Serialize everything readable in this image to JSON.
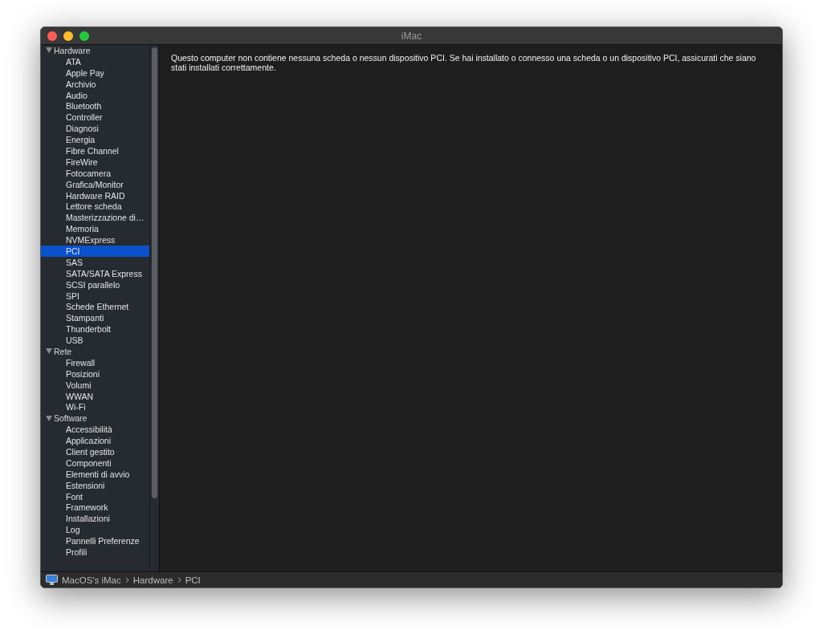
{
  "window": {
    "title": "iMac"
  },
  "sidebar": {
    "sections": [
      {
        "label": "Hardware",
        "expanded": true,
        "children": [
          {
            "label": "ATA",
            "selected": false
          },
          {
            "label": "Apple Pay",
            "selected": false
          },
          {
            "label": "Archivio",
            "selected": false
          },
          {
            "label": "Audio",
            "selected": false
          },
          {
            "label": "Bluetooth",
            "selected": false
          },
          {
            "label": "Controller",
            "selected": false
          },
          {
            "label": "Diagnosi",
            "selected": false
          },
          {
            "label": "Energia",
            "selected": false
          },
          {
            "label": "Fibre Channel",
            "selected": false
          },
          {
            "label": "FireWire",
            "selected": false
          },
          {
            "label": "Fotocamera",
            "selected": false
          },
          {
            "label": "Grafica/Monitor",
            "selected": false
          },
          {
            "label": "Hardware RAID",
            "selected": false
          },
          {
            "label": "Lettore scheda",
            "selected": false
          },
          {
            "label": "Masterizzazione di…",
            "selected": false
          },
          {
            "label": "Memoria",
            "selected": false
          },
          {
            "label": "NVMExpress",
            "selected": false
          },
          {
            "label": "PCI",
            "selected": true
          },
          {
            "label": "SAS",
            "selected": false
          },
          {
            "label": "SATA/SATA Express",
            "selected": false
          },
          {
            "label": "SCSI parallelo",
            "selected": false
          },
          {
            "label": "SPI",
            "selected": false
          },
          {
            "label": "Schede Ethernet",
            "selected": false
          },
          {
            "label": "Stampanti",
            "selected": false
          },
          {
            "label": "Thunderbolt",
            "selected": false
          },
          {
            "label": "USB",
            "selected": false
          }
        ]
      },
      {
        "label": "Rete",
        "expanded": true,
        "children": [
          {
            "label": "Firewall",
            "selected": false
          },
          {
            "label": "Posizioni",
            "selected": false
          },
          {
            "label": "Volumi",
            "selected": false
          },
          {
            "label": "WWAN",
            "selected": false
          },
          {
            "label": "Wi-Fi",
            "selected": false
          }
        ]
      },
      {
        "label": "Software",
        "expanded": true,
        "children": [
          {
            "label": "Accessibilità",
            "selected": false
          },
          {
            "label": "Applicazioni",
            "selected": false
          },
          {
            "label": "Client gestito",
            "selected": false
          },
          {
            "label": "Componenti",
            "selected": false
          },
          {
            "label": "Elementi di avvio",
            "selected": false
          },
          {
            "label": "Estensioni",
            "selected": false
          },
          {
            "label": "Font",
            "selected": false
          },
          {
            "label": "Framework",
            "selected": false
          },
          {
            "label": "Installazioni",
            "selected": false
          },
          {
            "label": "Log",
            "selected": false
          },
          {
            "label": "Pannelli Preferenze",
            "selected": false
          },
          {
            "label": "Profili",
            "selected": false
          }
        ]
      }
    ]
  },
  "content": {
    "message": "Questo computer non contiene nessuna scheda o nessun dispositivo PCI. Se hai installato o connesso una scheda o un dispositivo PCI, assicurati che siano stati installati correttamente."
  },
  "status_bar": {
    "path": [
      "MacOS's iMac",
      "Hardware",
      "PCI"
    ]
  }
}
